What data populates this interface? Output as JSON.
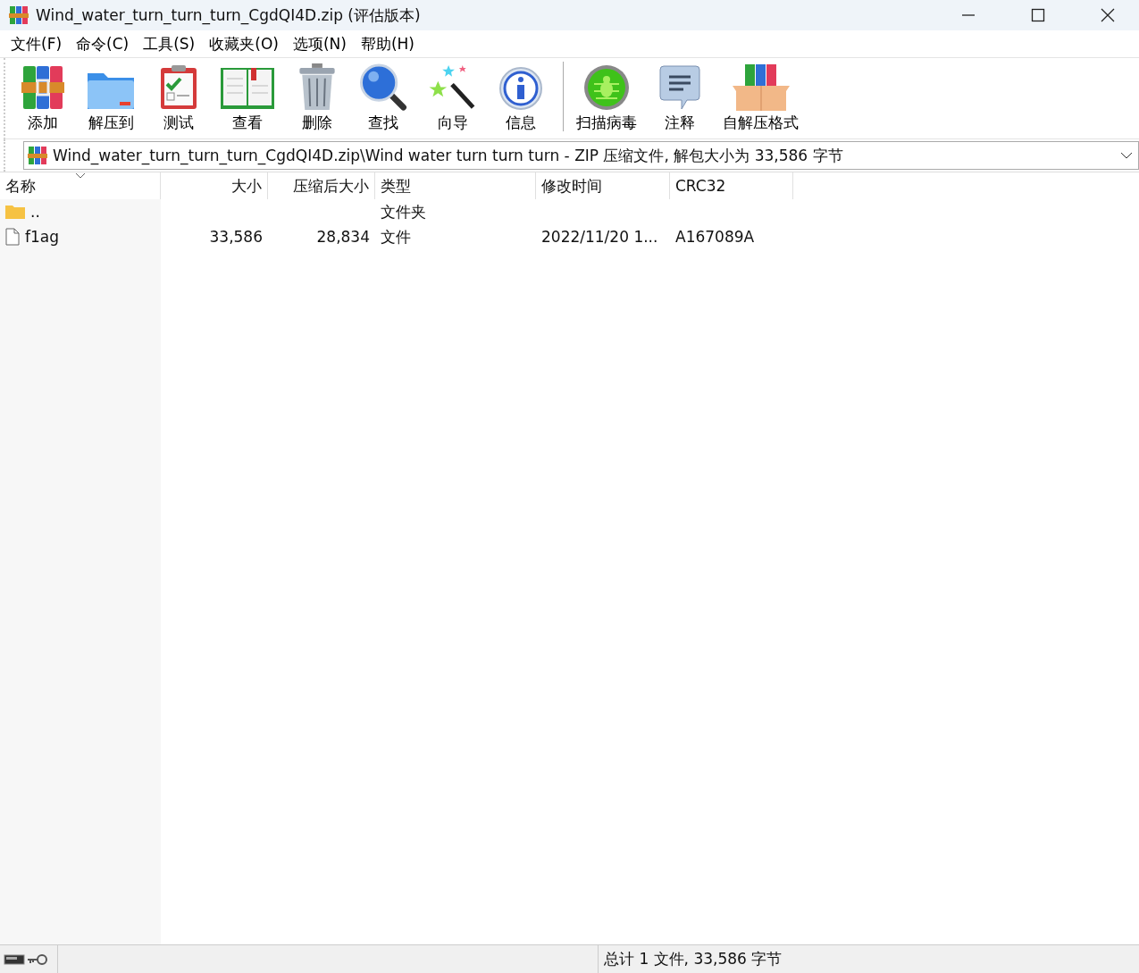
{
  "window": {
    "title": "Wind_water_turn_turn_turn_CgdQI4D.zip (评估版本)"
  },
  "menu": [
    "文件(F)",
    "命令(C)",
    "工具(S)",
    "收藏夹(O)",
    "选项(N)",
    "帮助(H)"
  ],
  "toolbar": {
    "groups": [
      {
        "buttons": [
          "添加",
          "解压到",
          "测试",
          "查看",
          "删除",
          "查找",
          "向导",
          "信息"
        ]
      },
      {
        "buttons": [
          "扫描病毒",
          "注释",
          "自解压格式"
        ]
      }
    ]
  },
  "address": {
    "path": "Wind_water_turn_turn_turn_CgdQI4D.zip\\Wind water turn turn turn - ZIP 压缩文件, 解包大小为 33,586 字节"
  },
  "table": {
    "columns": [
      {
        "label": "名称",
        "sorted": true
      },
      {
        "label": "大小",
        "sorted": false
      },
      {
        "label": "压缩后大小",
        "sorted": false
      },
      {
        "label": "类型",
        "sorted": false
      },
      {
        "label": "修改时间",
        "sorted": false
      },
      {
        "label": "CRC32",
        "sorted": false
      }
    ],
    "rows": [
      {
        "kind": "folder",
        "name": "..",
        "size": "",
        "packed": "",
        "type": "文件夹",
        "modified": "",
        "crc": ""
      },
      {
        "kind": "file",
        "name": "f1ag",
        "size": "33,586",
        "packed": "28,834",
        "type": "文件",
        "modified": "2022/11/20 1...",
        "crc": "A167089A"
      }
    ]
  },
  "status_bar": {
    "text": "总计 1 文件, 33,586 字节"
  }
}
